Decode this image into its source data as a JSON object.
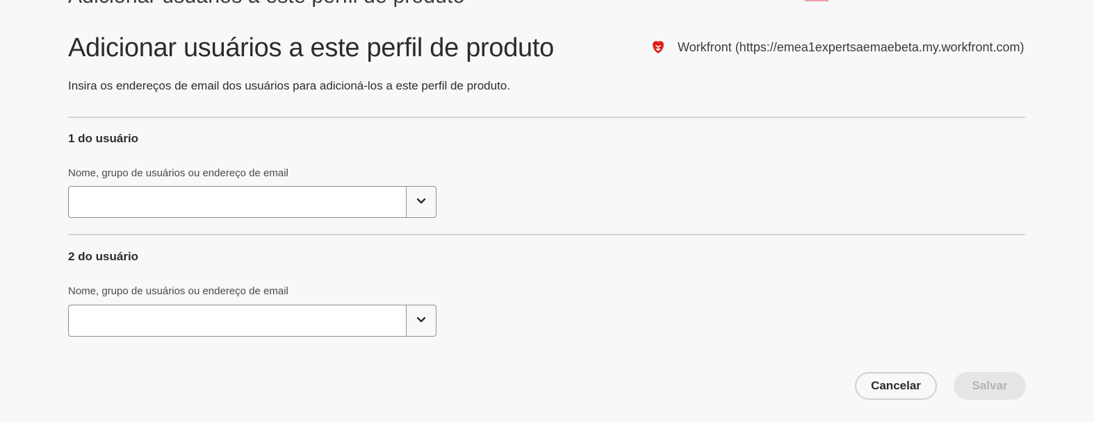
{
  "header": {
    "cut_title": "Adicionar usuários a este perfil de produto",
    "title": "Adicionar usuários a este perfil de produto",
    "org_icon": "brave-lion-icon",
    "org_label": "Workfront (https://emea1expertsaemaebeta.my.workfront.com)",
    "description": "Insira os endereços de email dos usuários para adicioná-los a este perfil de produto."
  },
  "users": [
    {
      "heading": "1 do usuário",
      "field_label": "Nome, grupo de usuários ou endereço de email",
      "value": "",
      "dropdown_icon": "chevron-down-icon"
    },
    {
      "heading": "2 do usuário",
      "field_label": "Nome, grupo de usuários ou endereço de email",
      "value": "",
      "dropdown_icon": "chevron-down-icon"
    }
  ],
  "footer": {
    "cancel_label": "Cancelar",
    "save_label": "Salvar",
    "save_disabled": true
  },
  "colors": {
    "background": "#f8f8f8",
    "divider": "#d3d3d3",
    "org_icon": "#e0201c",
    "disabled_button_bg": "#e6e6e6",
    "disabled_button_text": "#b3b3b3"
  }
}
